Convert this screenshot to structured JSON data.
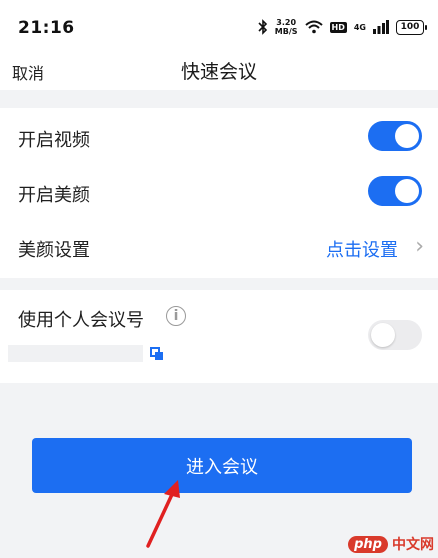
{
  "status_bar": {
    "time": "21:16",
    "speed_value": "3.20",
    "speed_unit": "MB/S",
    "hd_badge": "HD",
    "network": "4G",
    "battery": "100"
  },
  "nav": {
    "cancel_label": "取消",
    "title": "快速会议"
  },
  "settings": {
    "video_label": "开启视频",
    "video_on": true,
    "beauty_label": "开启美颜",
    "beauty_on": true,
    "beauty_settings_label": "美颜设置",
    "beauty_settings_link": "点击设置",
    "personal_id_label": "使用个人会议号",
    "personal_id_on": false
  },
  "enter_button_label": "进入会议",
  "watermark": {
    "logo": "php",
    "text": "中文网"
  },
  "colors": {
    "accent": "#1c6ef2",
    "background": "#f2f3f5",
    "annotation_arrow": "#e02020"
  }
}
